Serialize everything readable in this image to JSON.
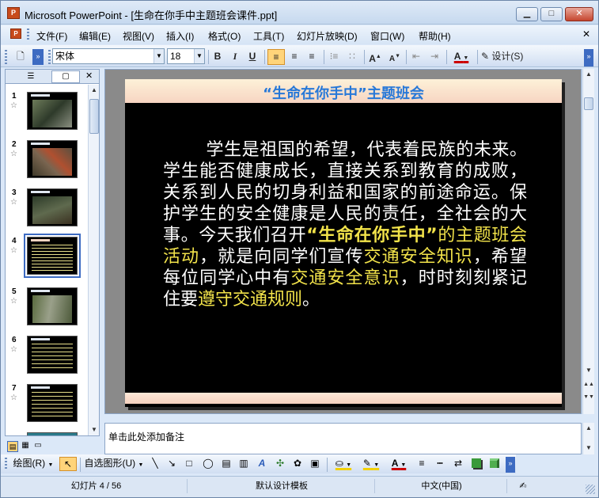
{
  "window": {
    "app_icon": "PowerPoint",
    "title": "Microsoft PowerPoint - [生命在你手中主题班会课件.ppt]",
    "min_label": "▭",
    "max_label": "□",
    "close_label": "✕"
  },
  "menu": {
    "items": [
      "文件(F)",
      "编辑(E)",
      "视图(V)",
      "插入(I)",
      "格式(O)",
      "工具(T)",
      "幻灯片放映(D)",
      "窗口(W)",
      "帮助(H)"
    ],
    "doc_close": "✕"
  },
  "toolbar": {
    "font_name": "宋体",
    "font_size": "18",
    "bold": "B",
    "italic": "I",
    "underline": "U",
    "font_color_label": "A",
    "design_label": "设计(S)"
  },
  "left_panel": {
    "tab_outline_icon": "outline-tab-icon",
    "tab_slides_icon": "slides-tab-icon",
    "close": "✕",
    "slides": [
      {
        "num": "1",
        "kind": "photo"
      },
      {
        "num": "2",
        "kind": "photo"
      },
      {
        "num": "3",
        "kind": "photo"
      },
      {
        "num": "4",
        "kind": "text",
        "selected": true
      },
      {
        "num": "5",
        "kind": "photo"
      },
      {
        "num": "6",
        "kind": "text"
      },
      {
        "num": "7",
        "kind": "text"
      }
    ]
  },
  "slide": {
    "title": "“生命在你手中”主题班会",
    "body_parts": [
      {
        "text": "学生是祖国的希望，代表着民族的未来。学生能否健康成长，直接关系到教育的成败，关系到人民的切身利益和国家的前途命运。保护学生的安全健康是人民的责任，全社会的大事。今天我们召开",
        "color": "white"
      },
      {
        "text": "“生命在你手中”",
        "color": "yellow-bold"
      },
      {
        "text": "的主题班会活动",
        "color": "yellow"
      },
      {
        "text": "，就是向同学们宣传",
        "color": "white"
      },
      {
        "text": "交通安全知识",
        "color": "yellow"
      },
      {
        "text": "，希望每位同学心中有",
        "color": "white"
      },
      {
        "text": "交通安全意识",
        "color": "yellow"
      },
      {
        "text": "，时时刻刻紧记住要",
        "color": "white"
      },
      {
        "text": "遵守交通规则",
        "color": "yellow"
      },
      {
        "text": "。",
        "color": "white"
      }
    ],
    "colors": {
      "title": "#2778d8",
      "body": "#ffffff",
      "highlight": "#f2e34a"
    }
  },
  "notes": {
    "placeholder": "单击此处添加备注"
  },
  "drawbar": {
    "draw_label": "绘图(R)",
    "autoshapes_label": "自选图形(U)"
  },
  "status": {
    "slide_pos": "幻灯片 4 / 56",
    "design": "默认设计模板",
    "language": "中文(中国)"
  }
}
